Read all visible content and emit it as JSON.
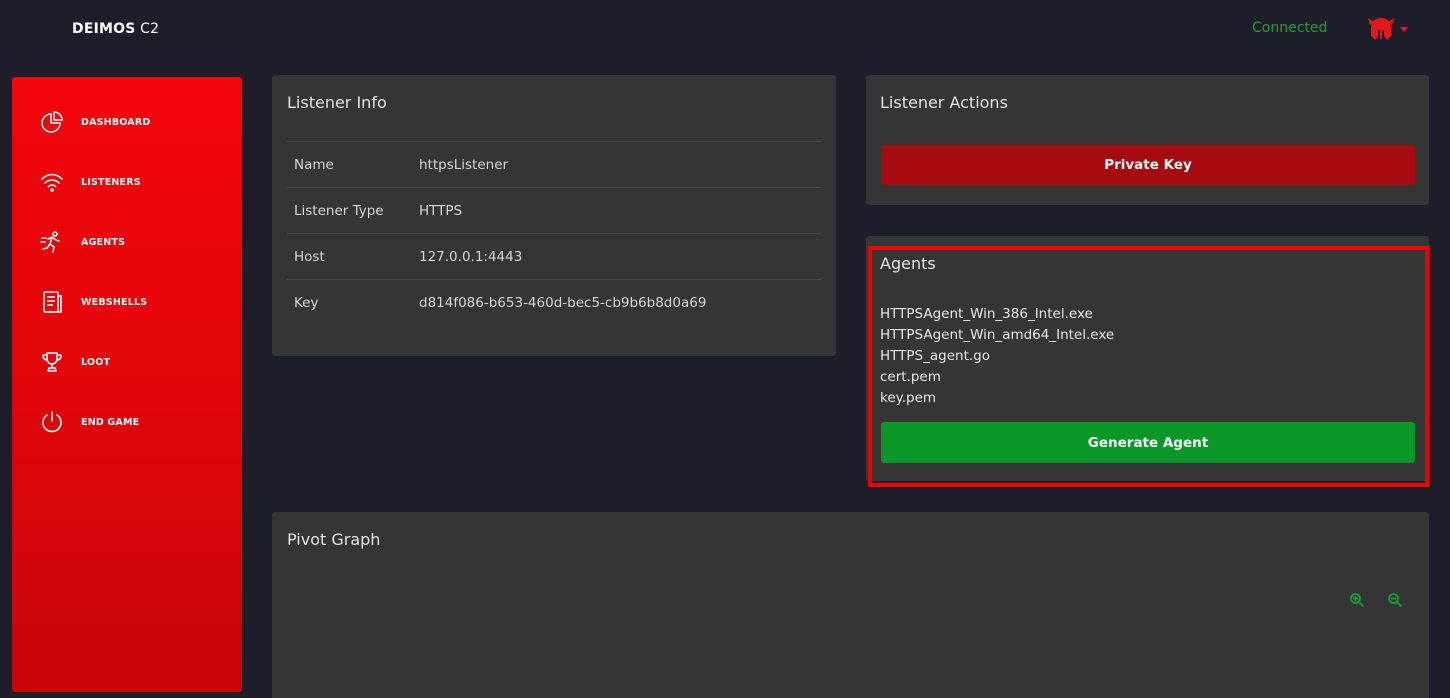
{
  "header": {
    "brand_bold": "DEIMOS",
    "brand_light": " C2",
    "status": "Connected",
    "avatar_icon": "spartan-helmet-icon",
    "accent_color": "#e8151b",
    "status_color": "#1f9e3a"
  },
  "sidebar": {
    "items": [
      {
        "label": "DASHBOARD",
        "icon": "pie-chart-icon"
      },
      {
        "label": "LISTENERS",
        "icon": "wifi-icon"
      },
      {
        "label": "AGENTS",
        "icon": "running-person-icon"
      },
      {
        "label": "WEBSHELLS",
        "icon": "document-icon"
      },
      {
        "label": "LOOT",
        "icon": "trophy-icon"
      },
      {
        "label": "END GAME",
        "icon": "power-icon"
      }
    ]
  },
  "listener_info": {
    "title": "Listener Info",
    "rows": [
      {
        "key": "Name",
        "value": "httpsListener"
      },
      {
        "key": "Listener Type",
        "value": "HTTPS"
      },
      {
        "key": "Host",
        "value": "127.0.0.1:4443"
      },
      {
        "key": "Key",
        "value": "d814f086-b653-460d-bec5-cb9b6b8d0a69"
      }
    ]
  },
  "listener_actions": {
    "title": "Listener Actions",
    "private_key_label": "Private Key",
    "button_color": "#a50a0f"
  },
  "agents": {
    "title": "Agents",
    "files": [
      "HTTPSAgent_Win_386_Intel.exe",
      "HTTPSAgent_Win_amd64_Intel.exe",
      "HTTPS_agent.go",
      "cert.pem",
      "key.pem"
    ],
    "generate_label": "Generate Agent",
    "button_color": "#0b9628"
  },
  "pivot_graph": {
    "title": "Pivot Graph",
    "zoom_in_icon": "zoom-in-icon",
    "zoom_out_icon": "zoom-out-icon"
  }
}
